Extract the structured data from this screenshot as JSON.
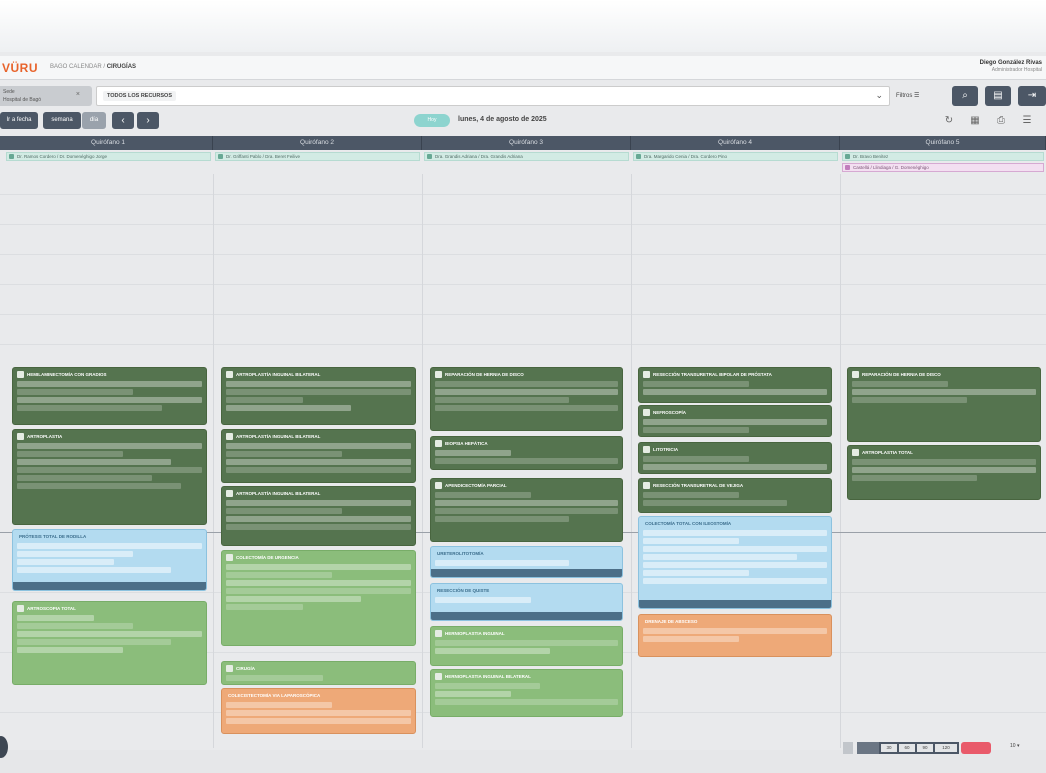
{
  "header": {
    "logo": "VÜRU",
    "breadcrumb_prefix": "BAGO CALENDAR /",
    "breadcrumb_current": "CIRUGÍAS",
    "user_name": "Diego González Rivas",
    "user_role": "Administrador Hospital"
  },
  "filters": {
    "left_chip_line1": "Sede",
    "left_chip_line2": "Hospital de Bagó",
    "left_chip_close": "×",
    "resource_tag": "TODOS LOS RECURSOS",
    "resource_chevron": "⌄",
    "filtros_label": "Filtros ☰"
  },
  "nav": {
    "ir_a_fecha": "Ir a fecha",
    "semana": "semana",
    "dia": "día",
    "prev": "‹",
    "next": "›",
    "today": "Hoy",
    "date_title": "lunes, 4 de agosto de 2025"
  },
  "columns": [
    "Quirófano 1",
    "Quirófano 2",
    "Quirófano 3",
    "Quirófano 4",
    "Quirófano 5"
  ],
  "staff": [
    "Dr. Ramos Cordero / Dr. Domenéghigo Jorge",
    "Dr. Griffanti Pablo / Dra. Beret Feilive",
    "Dra. Grandis Adriana / Dra. Grandis Adriana",
    "Dra. Margarido Cenia / Dra. Cordero Pino",
    "Dr. Bravo Benítez"
  ],
  "staff_extra": "Castellá / Llindiaga / G. Domenéghigo",
  "cards": {
    "c1a": "HEMILAMINECTOMÍA CON GRADIOS",
    "c1b": "ARTROPLASTIA",
    "c1c": "PRÓTESIS TOTAL DE RODILLA",
    "c1d": "ARTROSCOPIA TOTAL",
    "c2a": "ARTROPLASTÍA INGUINAL BILATERAL",
    "c2b": "ARTROPLASTÍA INGUINAL BILATERAL",
    "c2c": "ARTROPLASTÍA INGUINAL BILATERAL",
    "c2d": "COLECTOMÍA DE URGENCIA",
    "c2e": "CIRUGÍA",
    "c2f": "COLECISTECTOMÍA VIA LAPAROSCÓPICA",
    "c3a": "REPARACIÓN DE HERNIA DE DISCO",
    "c3b": "BIOPSIA HEPÁTICA",
    "c3c": "APENDICECTOMÍA PARCIAL",
    "c3d": "URETEROLITOTOMÍA",
    "c3e": "RESECCIÓN DE QUISTE",
    "c3f": "HERNIOPLASTIA INGUINAL",
    "c3g": "HERNIOPLASTIA INGUINAL BILATERAL",
    "c4a": "RESECCIÓN TRANSURETRAL BIPOLAR DE PRÓSTATA",
    "c4b": "NEFROSCOPÍA",
    "c4c": "LITOTRICIA",
    "c4d": "RESECCIÓN TRANSURETRAL DE VEJIGA",
    "c4e": "COLECTOMÍA TOTAL CON ILEOSTOMÍA",
    "c4f": "DRENAJE DE ABSCESO",
    "c5a": "REPARACIÓN DE HERNIA DE DISCO",
    "c5b": "ARTROPLASTIA TOTAL"
  },
  "bottom": {
    "zoom_a": "30",
    "zoom_b": "60",
    "zoom_c": "90",
    "zoom_d": "120",
    "page_size": "10 ▾"
  }
}
